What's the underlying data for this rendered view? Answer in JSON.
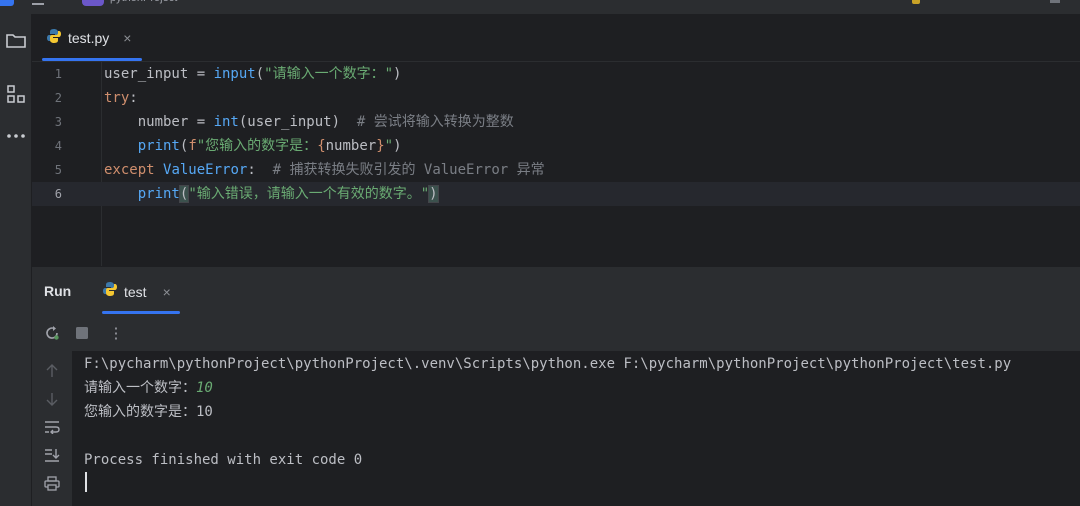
{
  "titlebar": {
    "project_label": "pythonProject"
  },
  "editor": {
    "tab": {
      "filename": "test.py",
      "close": "×",
      "icon": "python-file-icon"
    },
    "lines": [
      {
        "num": "1",
        "parts": [
          [
            "",
            "user_input = "
          ],
          [
            "fn",
            "input"
          ],
          [
            "",
            "("
          ],
          [
            "str",
            "\"请输入一个数字：\""
          ],
          [
            "",
            ")"
          ]
        ]
      },
      {
        "num": "2",
        "parts": [
          [
            "kw",
            "try"
          ],
          [
            "",
            ":"
          ]
        ]
      },
      {
        "num": "3",
        "parts": [
          [
            "",
            "    number = "
          ],
          [
            "fn",
            "int"
          ],
          [
            "",
            "(user_input)  "
          ],
          [
            "cmt",
            "# 尝试将输入转换为整数"
          ]
        ]
      },
      {
        "num": "4",
        "parts": [
          [
            "",
            "    "
          ],
          [
            "fn",
            "print"
          ],
          [
            "",
            "("
          ],
          [
            "kw",
            "f"
          ],
          [
            "str",
            "\"您输入的数字是："
          ],
          [
            "kw",
            "{"
          ],
          [
            "",
            "number"
          ],
          [
            "kw",
            "}"
          ],
          [
            "str",
            "\""
          ],
          [
            "",
            ")"
          ]
        ]
      },
      {
        "num": "5",
        "parts": [
          [
            "kw",
            "except "
          ],
          [
            "fn",
            "ValueError"
          ],
          [
            "",
            ":  "
          ],
          [
            "cmt",
            "# 捕获转换失败引发的 ValueError 异常"
          ]
        ]
      },
      {
        "num": "6",
        "parts": [
          [
            "",
            "    "
          ],
          [
            "fn",
            "print"
          ],
          [
            "brh",
            "("
          ],
          [
            "str",
            "\"输入错误，请输入一个有效的数字。\""
          ],
          [
            "brh",
            ")"
          ]
        ]
      }
    ],
    "current_line": 6
  },
  "run": {
    "title": "Run",
    "tab": {
      "name": "test",
      "close": "×",
      "icon": "python-file-icon"
    },
    "toolbar": {
      "rerun_icon": "rerun-icon",
      "stop_icon": "stop-icon",
      "more_icon": "more-vertical-icon",
      "more": "⋮"
    },
    "side_tools": [
      "arrow-up-icon",
      "arrow-down-icon",
      "soft-wrap-icon",
      "scroll-to-end-icon",
      "print-icon"
    ],
    "console": {
      "command": "F:\\pycharm\\pythonProject\\pythonProject\\.venv\\Scripts\\python.exe F:\\pycharm\\pythonProject\\pythonProject\\test.py",
      "prompt": "请输入一个数字：",
      "user_input": "10",
      "result": "您输入的数字是：10",
      "blank": "",
      "exit": "Process finished with exit code 0"
    }
  },
  "colors": {
    "accent": "#3574f0",
    "keyword": "#cf8e6d",
    "function": "#56a8f5",
    "string": "#6aab73",
    "comment": "#7a7e85",
    "background": "#1e1f22",
    "panel": "#2b2d30"
  }
}
